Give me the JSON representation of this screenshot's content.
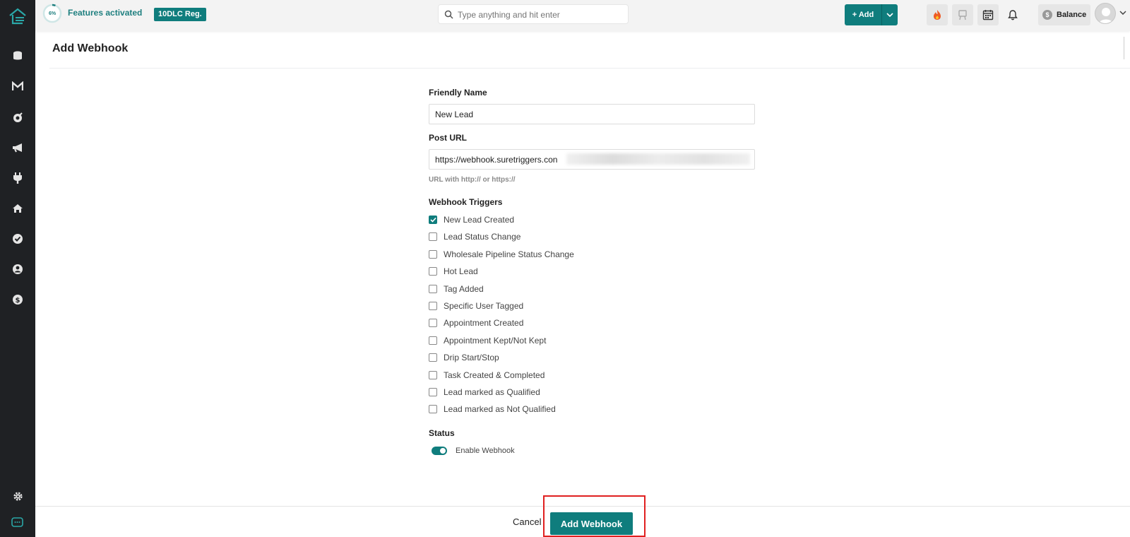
{
  "topbar": {
    "progress": "6%",
    "progress_fraction": 0.06,
    "features_label": "Features activated",
    "tendlc_label": "10DLC Reg.",
    "search_placeholder": "Type anything and hit enter",
    "add_label": "+ Add",
    "balance_label": "Balance",
    "balance_icon": "$"
  },
  "sidebar": {
    "items": [
      "database-icon",
      "mail-icon",
      "target-icon",
      "megaphone-icon",
      "plug-icon",
      "home-icon",
      "check-circle-icon",
      "user-circle-icon",
      "dollar-icon"
    ],
    "bottom": [
      "gear-icon",
      "chat-icon"
    ]
  },
  "page": {
    "title": "Add Webhook"
  },
  "form": {
    "friendly_name_label": "Friendly Name",
    "friendly_name_value": "New Lead",
    "post_url_label": "Post URL",
    "post_url_value": "https://webhook.suretriggers.con",
    "post_url_hint": "URL with http:// or https://",
    "triggers_label": "Webhook Triggers",
    "triggers": [
      {
        "label": "New Lead Created",
        "checked": true
      },
      {
        "label": "Lead Status Change",
        "checked": false
      },
      {
        "label": "Wholesale Pipeline Status Change",
        "checked": false
      },
      {
        "label": "Hot Lead",
        "checked": false
      },
      {
        "label": "Tag Added",
        "checked": false
      },
      {
        "label": "Specific User Tagged",
        "checked": false
      },
      {
        "label": "Appointment Created",
        "checked": false
      },
      {
        "label": "Appointment Kept/Not Kept",
        "checked": false
      },
      {
        "label": "Drip Start/Stop",
        "checked": false
      },
      {
        "label": "Task Created & Completed",
        "checked": false
      },
      {
        "label": "Lead marked as Qualified",
        "checked": false
      },
      {
        "label": "Lead marked as Not Qualified",
        "checked": false
      }
    ],
    "status_label": "Status",
    "enable_label": "Enable Webhook",
    "enabled": true
  },
  "footer": {
    "cancel_label": "Cancel",
    "submit_label": "Add Webhook"
  },
  "colors": {
    "accent": "#0f7d7d",
    "sidebar": "#1f2124",
    "highlight": "#e02020"
  }
}
